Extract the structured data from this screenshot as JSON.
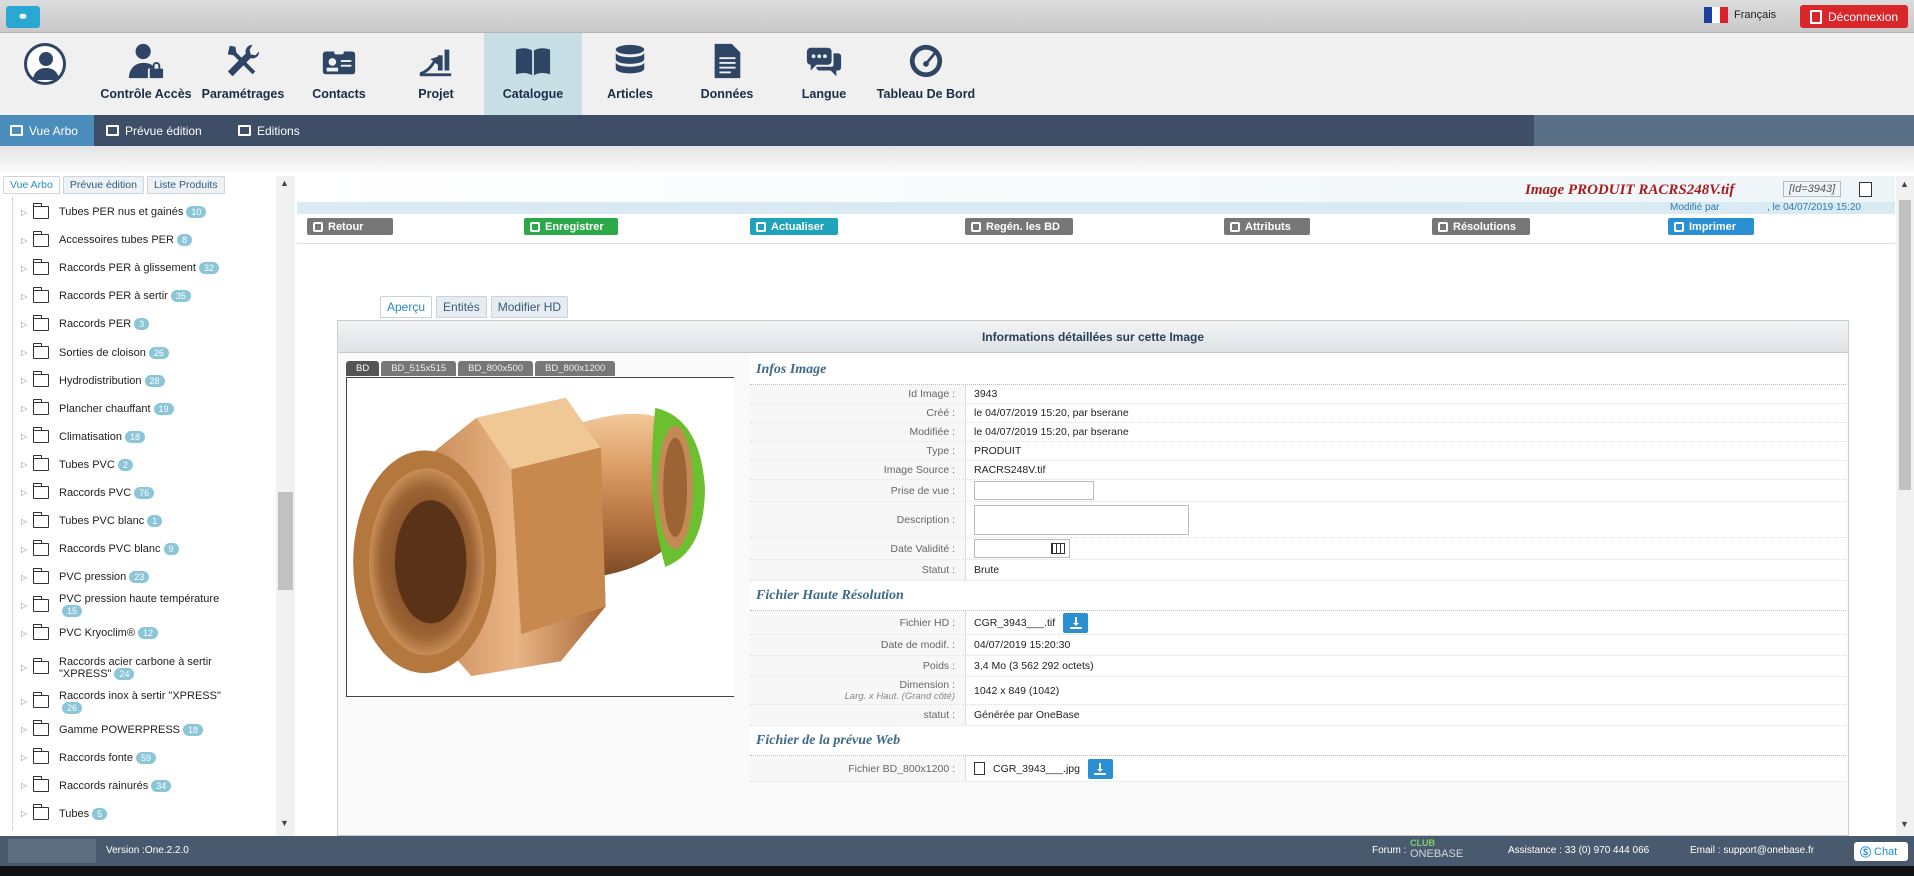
{
  "topbar": {
    "language": "Français",
    "logout_label": "Déconnexion"
  },
  "nav": {
    "items": [
      {
        "label": "Contrôle Accès",
        "icon": "user-lock-icon"
      },
      {
        "label": "Paramétrages",
        "icon": "tools-icon"
      },
      {
        "label": "Contacts",
        "icon": "contact-card-icon"
      },
      {
        "label": "Projet",
        "icon": "project-chart-icon"
      },
      {
        "label": "Catalogue",
        "icon": "book-icon"
      },
      {
        "label": "Articles",
        "icon": "database-icon"
      },
      {
        "label": "Données",
        "icon": "document-icon"
      },
      {
        "label": "Langue",
        "icon": "chat-bubbles-icon"
      },
      {
        "label": "Tableau De Bord",
        "icon": "gauge-icon"
      }
    ],
    "active": "Catalogue"
  },
  "subnav": {
    "items": [
      "Vue Arbo",
      "Prévue édition",
      "Editions"
    ]
  },
  "sidebar": {
    "tabs": [
      "Vue Arbo",
      "Prévue édition",
      "Liste Produits"
    ],
    "tree": [
      {
        "label": "Tubes PER nus et gainés",
        "count": "10"
      },
      {
        "label": "Accessoires tubes PER",
        "count": "8"
      },
      {
        "label": "Raccords PER à glissement",
        "count": "32"
      },
      {
        "label": "Raccords PER à sertir",
        "count": "35"
      },
      {
        "label": "Raccords PER",
        "count": "3"
      },
      {
        "label": "Sorties de cloison",
        "count": "26"
      },
      {
        "label": "Hydrodistribution",
        "count": "28"
      },
      {
        "label": "Plancher chauffant",
        "count": "19"
      },
      {
        "label": "Climatisation",
        "count": "18"
      },
      {
        "label": "Tubes PVC",
        "count": "2"
      },
      {
        "label": "Raccords PVC",
        "count": "76"
      },
      {
        "label": "Tubes PVC blanc",
        "count": "1"
      },
      {
        "label": "Raccords PVC blanc",
        "count": "9"
      },
      {
        "label": "PVC pression",
        "count": "23"
      },
      {
        "label": "PVC pression haute température",
        "count": "15"
      },
      {
        "label": "PVC Kryoclim®",
        "count": "12"
      },
      {
        "label": "Raccords acier carbone à sertir \"XPRESS\"",
        "count": "24"
      },
      {
        "label": "Raccords inox à sertir \"XPRESS\"",
        "count": "26"
      },
      {
        "label": "Gamme POWERPRESS",
        "count": "18"
      },
      {
        "label": "Raccords fonte",
        "count": "59"
      },
      {
        "label": "Raccords rainurés",
        "count": "34"
      },
      {
        "label": "Tubes",
        "count": "5"
      }
    ]
  },
  "page": {
    "title": "Image PRODUIT RACRS248V.tif",
    "id_tag": "[Id=3943]",
    "modified_by_label": "Modifié par",
    "modified_date": ", le 04/07/2019 15:20"
  },
  "toolbar": {
    "retour": "Retour",
    "enregistrer": "Enregistrer",
    "actualiser": "Actualiser",
    "regen": "Regén. les BD",
    "attributs": "Attributs",
    "resolutions": "Résolutions",
    "imprimer": "Imprimer"
  },
  "tabs": [
    "Aperçu",
    "Entités",
    "Modifier HD"
  ],
  "panel": {
    "header": "Informations détaillées sur cette Image",
    "image_tabs": [
      "BD",
      "BD_515x515",
      "BD_800x500",
      "BD_800x1200"
    ]
  },
  "infos_image": {
    "title": "Infos Image",
    "rows": [
      {
        "label": "Id Image :",
        "value": "3943"
      },
      {
        "label": "Créé :",
        "value": "le 04/07/2019 15:20, par bserane"
      },
      {
        "label": "Modifiée :",
        "value": "le 04/07/2019 15:20, par bserane"
      },
      {
        "label": "Type :",
        "value": "PRODUIT"
      },
      {
        "label": "Image Source :",
        "value": "RACRS248V.tif"
      }
    ],
    "prise_label": "Prise de vue :",
    "description_label": "Description :",
    "date_validite_label": "Date Validité :",
    "statut_label": "Statut :",
    "statut_value": "Brute"
  },
  "hd": {
    "title": "Fichier Haute Résolution",
    "fichier_label": "Fichier HD :",
    "fichier_value": "CGR_3943___.tif",
    "date_label": "Date de modif. :",
    "date_value": "04/07/2019 15:20:30",
    "poids_label": "Poids :",
    "poids_value": "3,4 Mo (3 562 292 octets)",
    "dimension_label": "Dimension :",
    "dimension_sub": "Larg. x Haut. (Grand côté)",
    "dimension_value": "1042 x 849 (1042)",
    "statut_label": "statut :",
    "statut_value": "Générée par OneBase"
  },
  "web": {
    "title": "Fichier de la prévue Web",
    "fichier_label": "Fichier BD_800x1200 :",
    "fichier_value": "CGR_3943___.jpg"
  },
  "footer": {
    "version": "Version :One.2.2.0",
    "forum": "Forum :",
    "club": "CLUB",
    "onebase": "ONEBASE",
    "assistance": "Assistance : 33 (0) 970 444 066",
    "email": "Email : support@onebase.fr",
    "chat": "Chat"
  }
}
